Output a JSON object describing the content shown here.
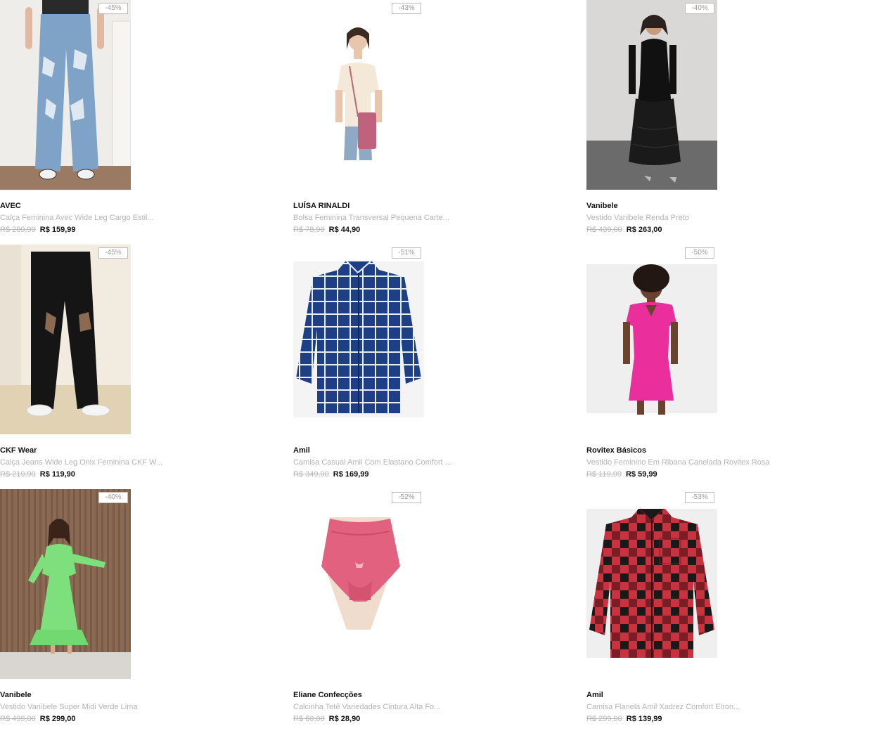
{
  "products": [
    {
      "discount": "-45%",
      "brand": "AVEC",
      "name": "Calça Feminina Avec Wide Leg Cargo Estil...",
      "old_price": "R$ 289,99",
      "price": "R$ 159,99"
    },
    {
      "discount": "-43%",
      "brand": "LUÍSA RINALDI",
      "name": "Bolsa Feminina Transversal Pequena Carte...",
      "old_price": "R$ 78,90",
      "price": "R$ 44,90"
    },
    {
      "discount": "-40%",
      "brand": "Vanibele",
      "name": "Vestido Vanibele Renda Preto",
      "old_price": "R$ 439,00",
      "price": "R$ 263,00"
    },
    {
      "discount": "-45%",
      "brand": "CKF Wear",
      "name": "Calça Jeans Wide Leg Onix Feminina CKF W...",
      "old_price": "R$ 219,90",
      "price": "R$ 119,90"
    },
    {
      "discount": "-51%",
      "brand": "Amil",
      "name": "Camisa Casual Amil Com Elastano Comfort ...",
      "old_price": "R$ 349,90",
      "price": "R$ 169,99"
    },
    {
      "discount": "-50%",
      "brand": "Rovitex Básicos",
      "name": "Vestido Feminino Em Ribana Canelada Rovitex Rosa",
      "old_price": "R$ 119,99",
      "price": "R$ 59,99"
    },
    {
      "discount": "-40%",
      "brand": "Vanibele",
      "name": "Vestido Vanibele Super Midi Verde Lima",
      "old_price": "R$ 499,00",
      "price": "R$ 299,00"
    },
    {
      "discount": "-52%",
      "brand": "Eliane Confecções",
      "name": "Calcinha Tetê Variedades Cintura Alta Fo...",
      "old_price": "R$ 60,00",
      "price": "R$ 28,90"
    },
    {
      "discount": "-53%",
      "brand": "Amil",
      "name": "Camisa Flanela Amil Xadrez Comfort Elron...",
      "old_price": "R$ 299,90",
      "price": "R$ 139,99"
    }
  ],
  "colors": {
    "badge_border": "#bdbdbd",
    "badge_text": "#9a9a9a",
    "brand_text": "#111111",
    "name_text": "#b4b4b4",
    "old_price_text": "#b8b8b8",
    "price_text": "#111111"
  }
}
